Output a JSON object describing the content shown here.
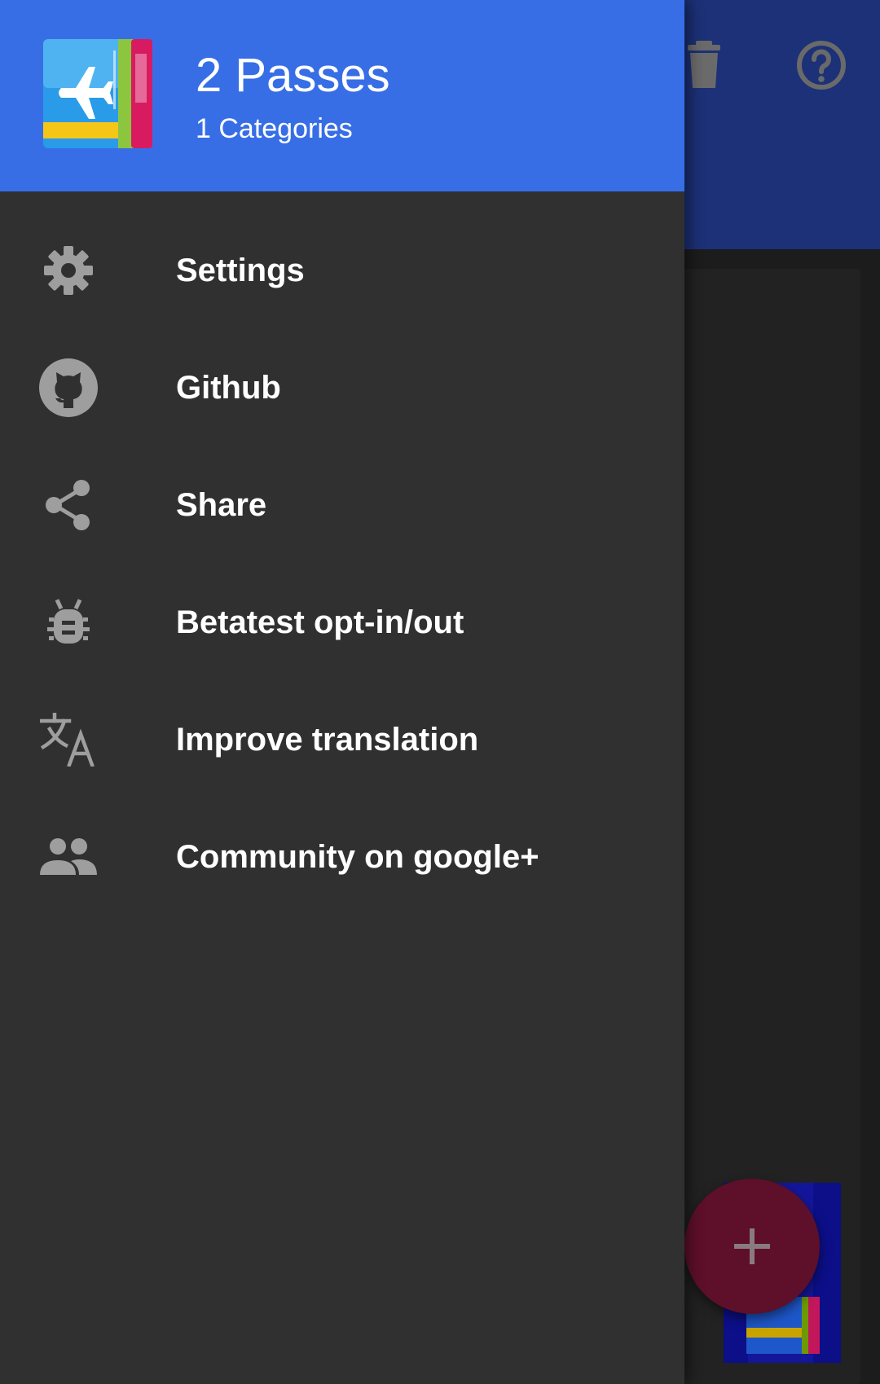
{
  "header": {
    "title": "2 Passes",
    "subtitle": "1 Categories"
  },
  "menu": {
    "items": [
      {
        "label": "Settings",
        "icon": "gear-icon"
      },
      {
        "label": "Github",
        "icon": "github-icon"
      },
      {
        "label": "Share",
        "icon": "share-icon"
      },
      {
        "label": "Betatest opt-in/out",
        "icon": "bug-icon"
      },
      {
        "label": "Improve translation",
        "icon": "translate-icon"
      },
      {
        "label": "Community on google+",
        "icon": "people-icon"
      }
    ]
  },
  "toolbar": {
    "actions": [
      "trash-icon",
      "help-icon"
    ]
  },
  "fab": {
    "icon": "plus-icon"
  },
  "colors": {
    "drawer_header": "#376ee6",
    "drawer_background": "#303030",
    "app_toolbar_dimmed": "#1c3177",
    "fab_dimmed": "#5e0f2a",
    "menu_icon": "#9e9e9e",
    "menu_text": "#ffffff"
  }
}
